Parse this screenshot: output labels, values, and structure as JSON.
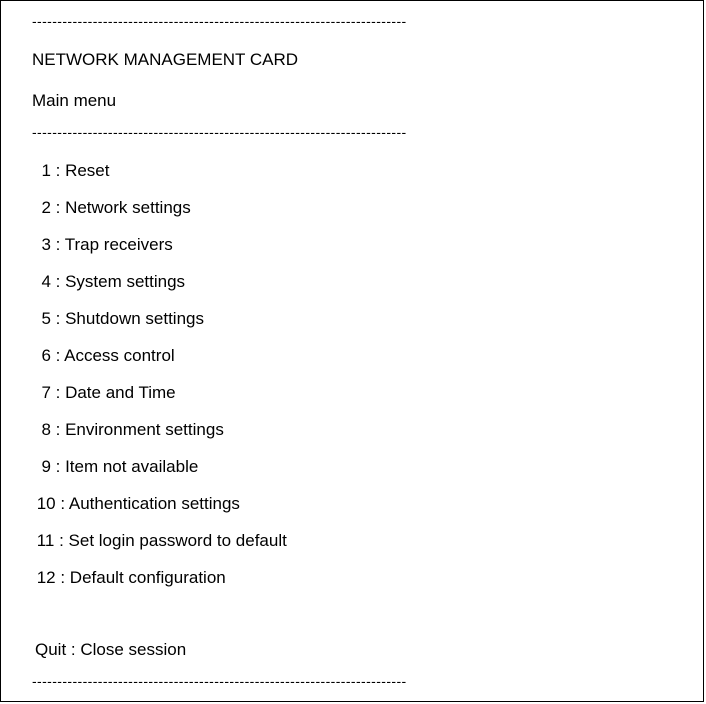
{
  "separator": "--------------------------------------------------------------------------",
  "header": {
    "title": "NETWORK MANAGEMENT CARD",
    "subtitle": "Main menu"
  },
  "menu": {
    "items": [
      {
        "label": "  1 : Reset"
      },
      {
        "label": "  2 : Network settings"
      },
      {
        "label": "  3 : Trap receivers"
      },
      {
        "label": "  4 : System settings"
      },
      {
        "label": "  5 : Shutdown settings"
      },
      {
        "label": "  6 : Access control"
      },
      {
        "label": "  7 : Date and Time"
      },
      {
        "label": "  8 : Environment settings"
      },
      {
        "label": "  9 : Item not available"
      },
      {
        "label": " 10 : Authentication settings"
      },
      {
        "label": " 11 : Set login password to default"
      },
      {
        "label": " 12 : Default configuration"
      }
    ],
    "quit": "Quit : Close session"
  }
}
